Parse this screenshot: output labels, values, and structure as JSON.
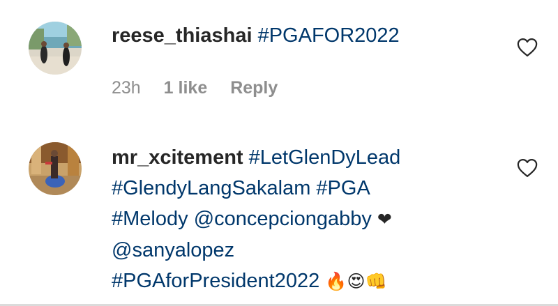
{
  "comments": [
    {
      "username": "reese_thiashai",
      "text_lines": [
        "#PGAFOR2022"
      ],
      "age": "23h",
      "likes": "1 like",
      "reply": "Reply"
    },
    {
      "username": "mr_xcitement",
      "line1_tag": "#LetGlenDyLead",
      "line2": "#GlendyLangSakalam #PGA",
      "line3_tag": "#Melody",
      "line3_mention": "@concepciongabby",
      "line3_emoji": "❤",
      "line4_mention": "@sanyalopez",
      "line5_tag": "#PGAforPresident2022",
      "line5_emoji": "🔥😍👊"
    }
  ],
  "colors": {
    "text": "#262626",
    "tag": "#00376b",
    "meta": "#8e8e8e"
  },
  "icons": {
    "like": "heart-outline-icon"
  }
}
